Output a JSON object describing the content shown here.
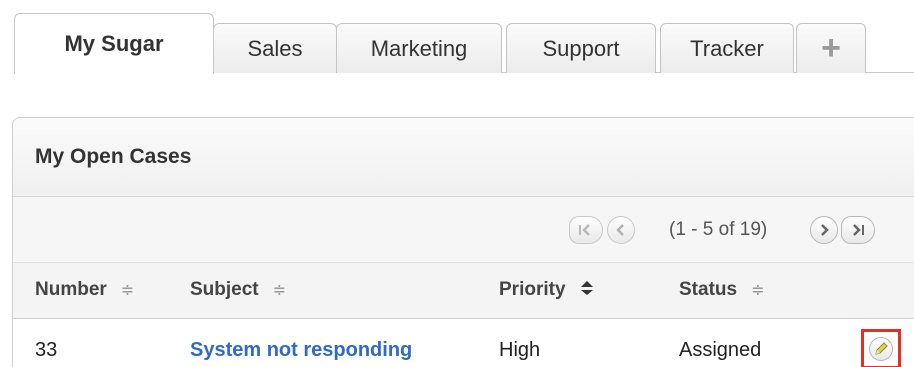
{
  "tabs": [
    {
      "label": "My Sugar",
      "active": true
    },
    {
      "label": "Sales"
    },
    {
      "label": "Marketing"
    },
    {
      "label": "Support"
    },
    {
      "label": "Tracker"
    },
    {
      "label": "+"
    }
  ],
  "dashlet": {
    "title": "My Open Cases",
    "pager": {
      "count_text": "(1 - 5 of 19)"
    },
    "columns": [
      {
        "label": "Number",
        "sort_icon": "≑"
      },
      {
        "label": "Subject",
        "sort_icon": "≑"
      },
      {
        "label": "Priority",
        "sort_icon": "≑"
      },
      {
        "label": "Status",
        "sort_icon": "≑"
      }
    ],
    "rows": [
      {
        "number": "33",
        "subject": "System not responding",
        "priority": "High",
        "status": "Assigned"
      }
    ]
  },
  "icons": {
    "first_page": "first-page-icon",
    "prev_page": "previous-page-icon",
    "next_page": "next-page-icon",
    "last_page": "last-page-icon",
    "edit": "pencil-icon"
  },
  "colors": {
    "link": "#2f6ac8",
    "highlight_box": "#e0302a",
    "pencil": "#e6d24a"
  }
}
